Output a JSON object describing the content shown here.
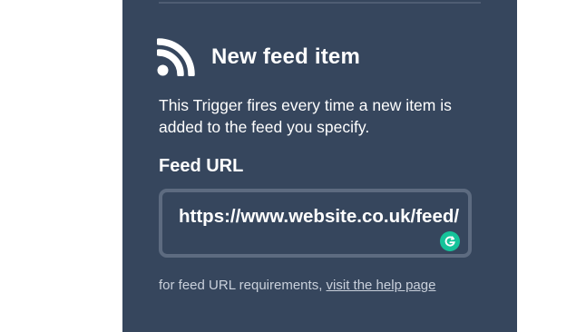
{
  "trigger": {
    "icon": "rss-feed-icon",
    "title": "New feed item",
    "description": "This Trigger fires every time a new item is added to the feed you specify."
  },
  "feed_url_field": {
    "label": "Feed URL",
    "value": "https://www.website.co.uk/feed/",
    "assistant_icon": "grammarly-icon"
  },
  "help": {
    "prefix": "for feed URL requirements,",
    "link_text": "visit the help page"
  },
  "colors": {
    "panel_background": "#36465d",
    "input_border": "#5d6b80",
    "text": "#ffffff",
    "muted_text": "#c9d0db",
    "grammarly": "#15c39a"
  }
}
